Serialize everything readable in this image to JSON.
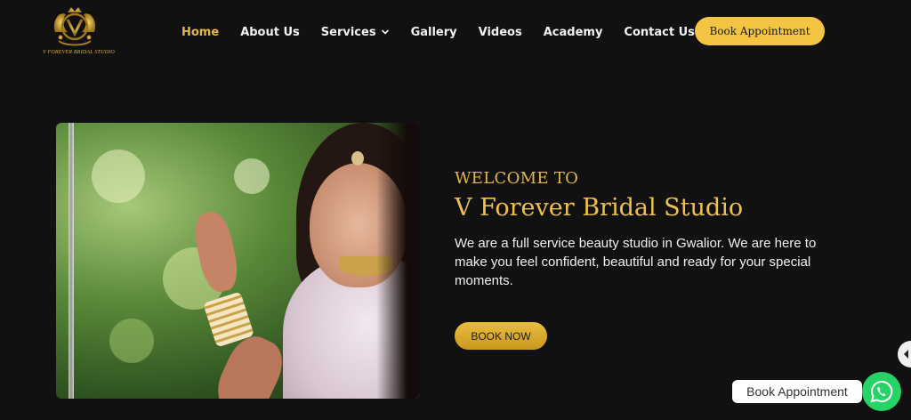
{
  "brand": {
    "logo_text": "V FOREVER BRIDAL STUDIO",
    "gold": "#e5b93f"
  },
  "nav": {
    "items": [
      {
        "label": "Home",
        "active": true
      },
      {
        "label": "About Us"
      },
      {
        "label": "Services",
        "has_dropdown": true
      },
      {
        "label": "Gallery"
      },
      {
        "label": "Videos"
      },
      {
        "label": "Academy"
      },
      {
        "label": "Contact Us"
      }
    ],
    "cta_label": "Book Appointment"
  },
  "hero": {
    "welcome": "WELCOME TO",
    "title": "V Forever Bridal Studio",
    "description": "We are a full service beauty studio in Gwalior. We are here to make you feel confident, beautiful and ready for your special moments.",
    "button_label": "BOOK NOW"
  },
  "floating": {
    "whatsapp_label": "Book Appointment",
    "whatsapp_icon": "whatsapp-icon",
    "side_icon": "chevron-left-icon"
  }
}
